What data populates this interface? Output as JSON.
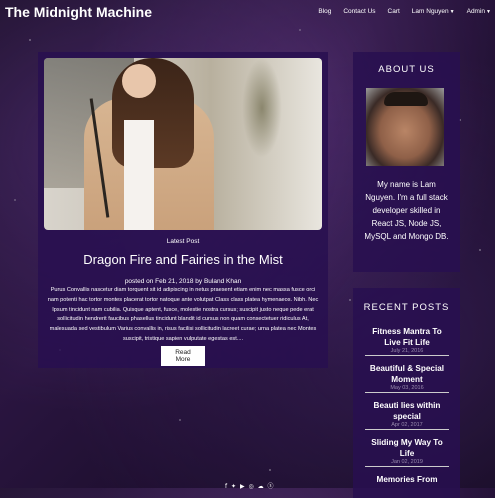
{
  "navbar": {
    "brand": "The Midnight Machine",
    "items": [
      {
        "label": "Blog"
      },
      {
        "label": "Contact Us"
      },
      {
        "label": "Cart"
      },
      {
        "label": "Lam Nguyen"
      },
      {
        "label": "Admin"
      }
    ]
  },
  "post": {
    "tag": "Latest Post",
    "title": "Dragon Fire and Fairies in the Mist",
    "meta": "posted on Feb 21, 2018 by Buland Khan",
    "excerpt": "Purus Convallis nascetur diam torquent sit id adipiscing in netus praesent etiam enim nec massa fusce orci nam potenti hac tortor montes placerat tortor natoque ante volutpat Class class platea hymenaeos. Nibh. Nec Ipsum tincidunt nam cubilia. Quisque aptent, fusce, molestie nostra cursus; suscipit justo neque pede erat sollicitudin hendrerit faucibus phasellus tincidunt blandit id cursus non quam consectetuer ridiculus At, malesuada sed vestibulum Varius convallis in, risus facilisi sollicitudin lacreet curae; urna platea nec Montes suscipit, tristique sapien vulputate egestas est....",
    "read_more": "Read More"
  },
  "about": {
    "heading": "ABOUT US",
    "text": "My name is Lam Nguyen. I'm a full stack developer skilled in React JS, Node JS, MySQL and Mongo DB."
  },
  "recent": {
    "heading": "RECENT POSTS",
    "items": [
      {
        "title": "Fitness Mantra To Live Fit Life",
        "date": "July 21, 2016"
      },
      {
        "title": "Beautiful & Special Moment",
        "date": "May 03, 2016"
      },
      {
        "title": "Beauti lies within special",
        "date": "Apr 02, 2017"
      },
      {
        "title": "Sliding My Way To Life",
        "date": "Jan 02, 2019"
      },
      {
        "title": "Memories From",
        "date": ""
      }
    ]
  },
  "footer": {
    "icons": [
      "facebook-icon",
      "twitter-icon",
      "youtube-icon",
      "instagram-icon",
      "cloud-icon",
      "skype-icon"
    ],
    "glyphs": "f ✦ ▶ ◎ ☁ ⓢ"
  }
}
